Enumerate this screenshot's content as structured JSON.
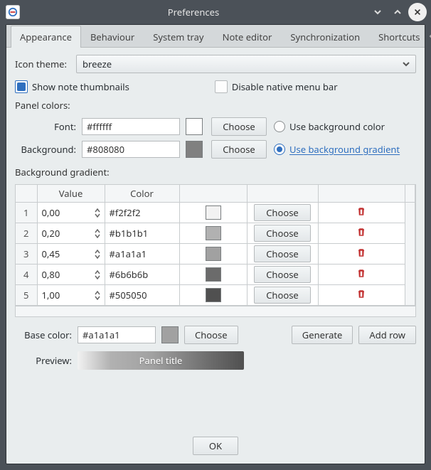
{
  "window": {
    "title": "Preferences"
  },
  "tabs": [
    {
      "label": "Appearance",
      "active": true
    },
    {
      "label": "Behaviour"
    },
    {
      "label": "System tray"
    },
    {
      "label": "Note editor"
    },
    {
      "label": "Synchronization"
    },
    {
      "label": "Shortcuts"
    }
  ],
  "icon_theme": {
    "label": "Icon theme:",
    "value": "breeze"
  },
  "checkboxes": {
    "show_thumbnails": {
      "label": "Show note thumbnails",
      "checked": true
    },
    "disable_native_menubar": {
      "label": "Disable native menu bar",
      "checked": false
    }
  },
  "panel_colors_label": "Panel colors:",
  "font_row": {
    "label": "Font:",
    "value": "#ffffff",
    "swatch": "#ffffff",
    "choose": "Choose",
    "radio": {
      "label": "Use background color",
      "checked": false
    }
  },
  "background_row": {
    "label": "Background:",
    "value": "#808080",
    "swatch": "#808080",
    "choose": "Choose",
    "radio": {
      "label": "Use background gradient",
      "checked": true
    }
  },
  "gradient": {
    "label": "Background gradient:",
    "headers": {
      "value": "Value",
      "color": "Color"
    },
    "choose": "Choose",
    "rows": [
      {
        "idx": "1",
        "value": "0,00",
        "hex": "#f2f2f2",
        "swatch": "#f2f2f2"
      },
      {
        "idx": "2",
        "value": "0,20",
        "hex": "#b1b1b1",
        "swatch": "#b1b1b1"
      },
      {
        "idx": "3",
        "value": "0,45",
        "hex": "#a1a1a1",
        "swatch": "#a1a1a1"
      },
      {
        "idx": "4",
        "value": "0,80",
        "hex": "#6b6b6b",
        "swatch": "#6b6b6b"
      },
      {
        "idx": "5",
        "value": "1,00",
        "hex": "#505050",
        "swatch": "#505050"
      }
    ]
  },
  "base_color": {
    "label": "Base color:",
    "value": "#a1a1a1",
    "swatch": "#a1a1a1",
    "choose": "Choose",
    "generate": "Generate",
    "add_row": "Add row"
  },
  "preview": {
    "label": "Preview:",
    "panel_title": "Panel title"
  },
  "footer": {
    "ok": "OK"
  }
}
